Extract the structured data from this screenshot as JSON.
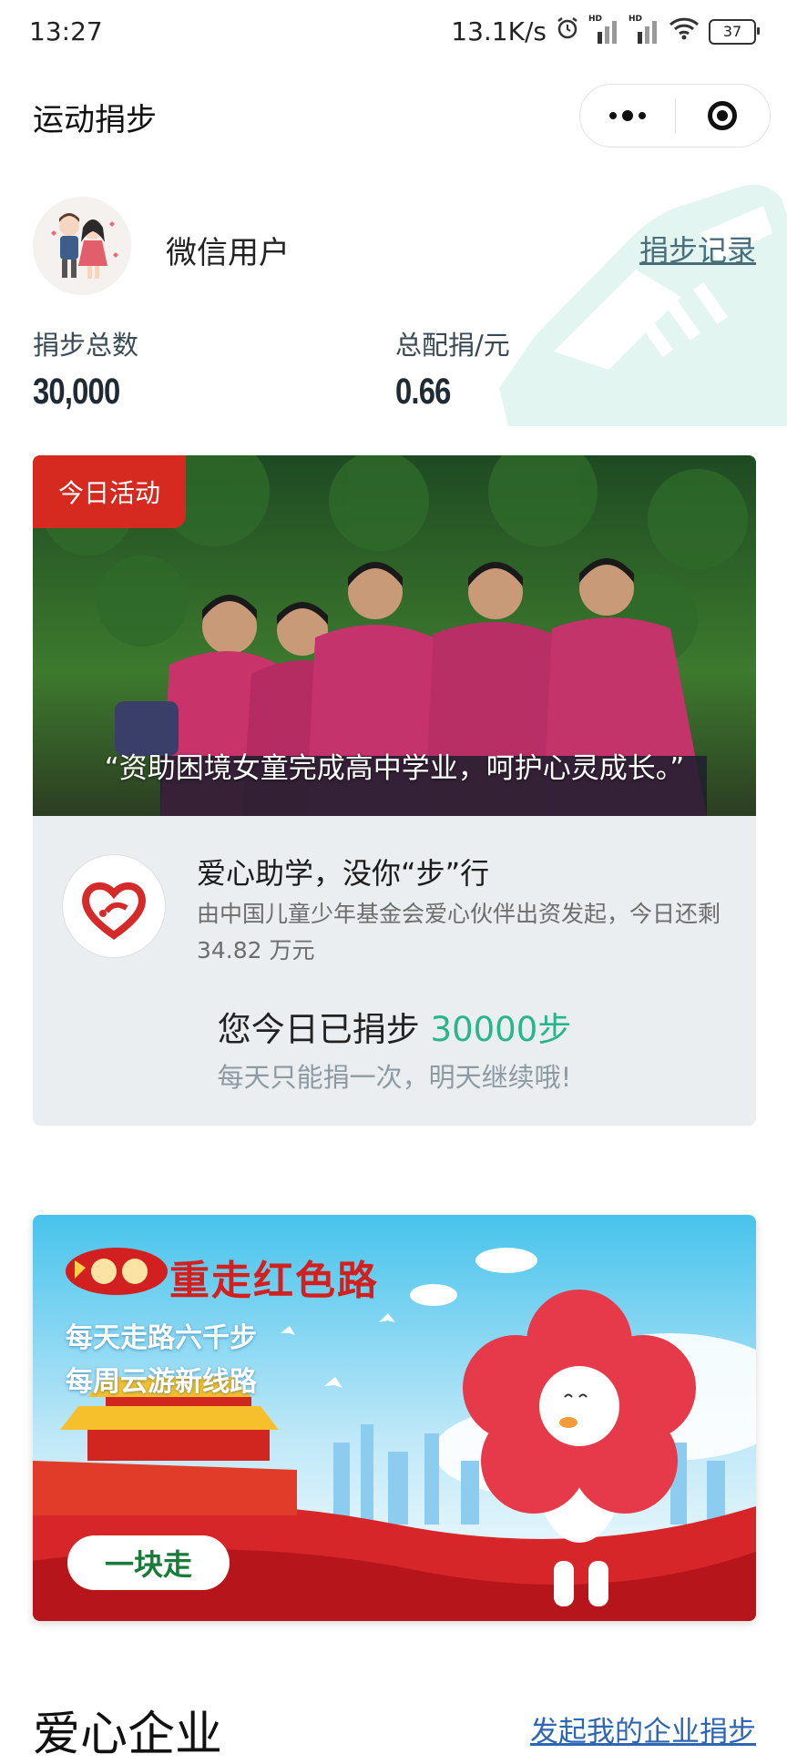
{
  "status_bar": {
    "time": "13:27",
    "net_speed": "13.1K/s",
    "sim_label": "HD",
    "battery": "37"
  },
  "nav": {
    "title": "运动捐步",
    "more_icon": "more-dots-icon",
    "close_icon": "target-close-icon"
  },
  "user": {
    "name": "微信用户",
    "record_link": "捐步记录",
    "stats": [
      {
        "label": "捐步总数",
        "value": "30,000"
      },
      {
        "label": "总配捐/元",
        "value": "0.66"
      }
    ]
  },
  "activity": {
    "tag": "今日活动",
    "quote": "“资助困境女童完成高中学业，呵护心灵成长。”",
    "title": "爱心助学，没你“步”行",
    "description": "由中国儿童少年基金会爱心伙伴出资发起，今日还剩 34.82 万元",
    "donated_prefix": "您今日已捐步 ",
    "donated_steps": "30000步",
    "once_note": "每天只能捐一次，明天继续哦!",
    "colors": {
      "tag": "#d62a21",
      "steps": "#27b58d"
    }
  },
  "banner": {
    "badge_number": "100",
    "title": "重走红色路",
    "lines": [
      "每天走路六千步",
      "每周云游新线路"
    ],
    "button": "一块走"
  },
  "companies": {
    "title": "爱心企业",
    "link": "发起我的企业捐步"
  }
}
